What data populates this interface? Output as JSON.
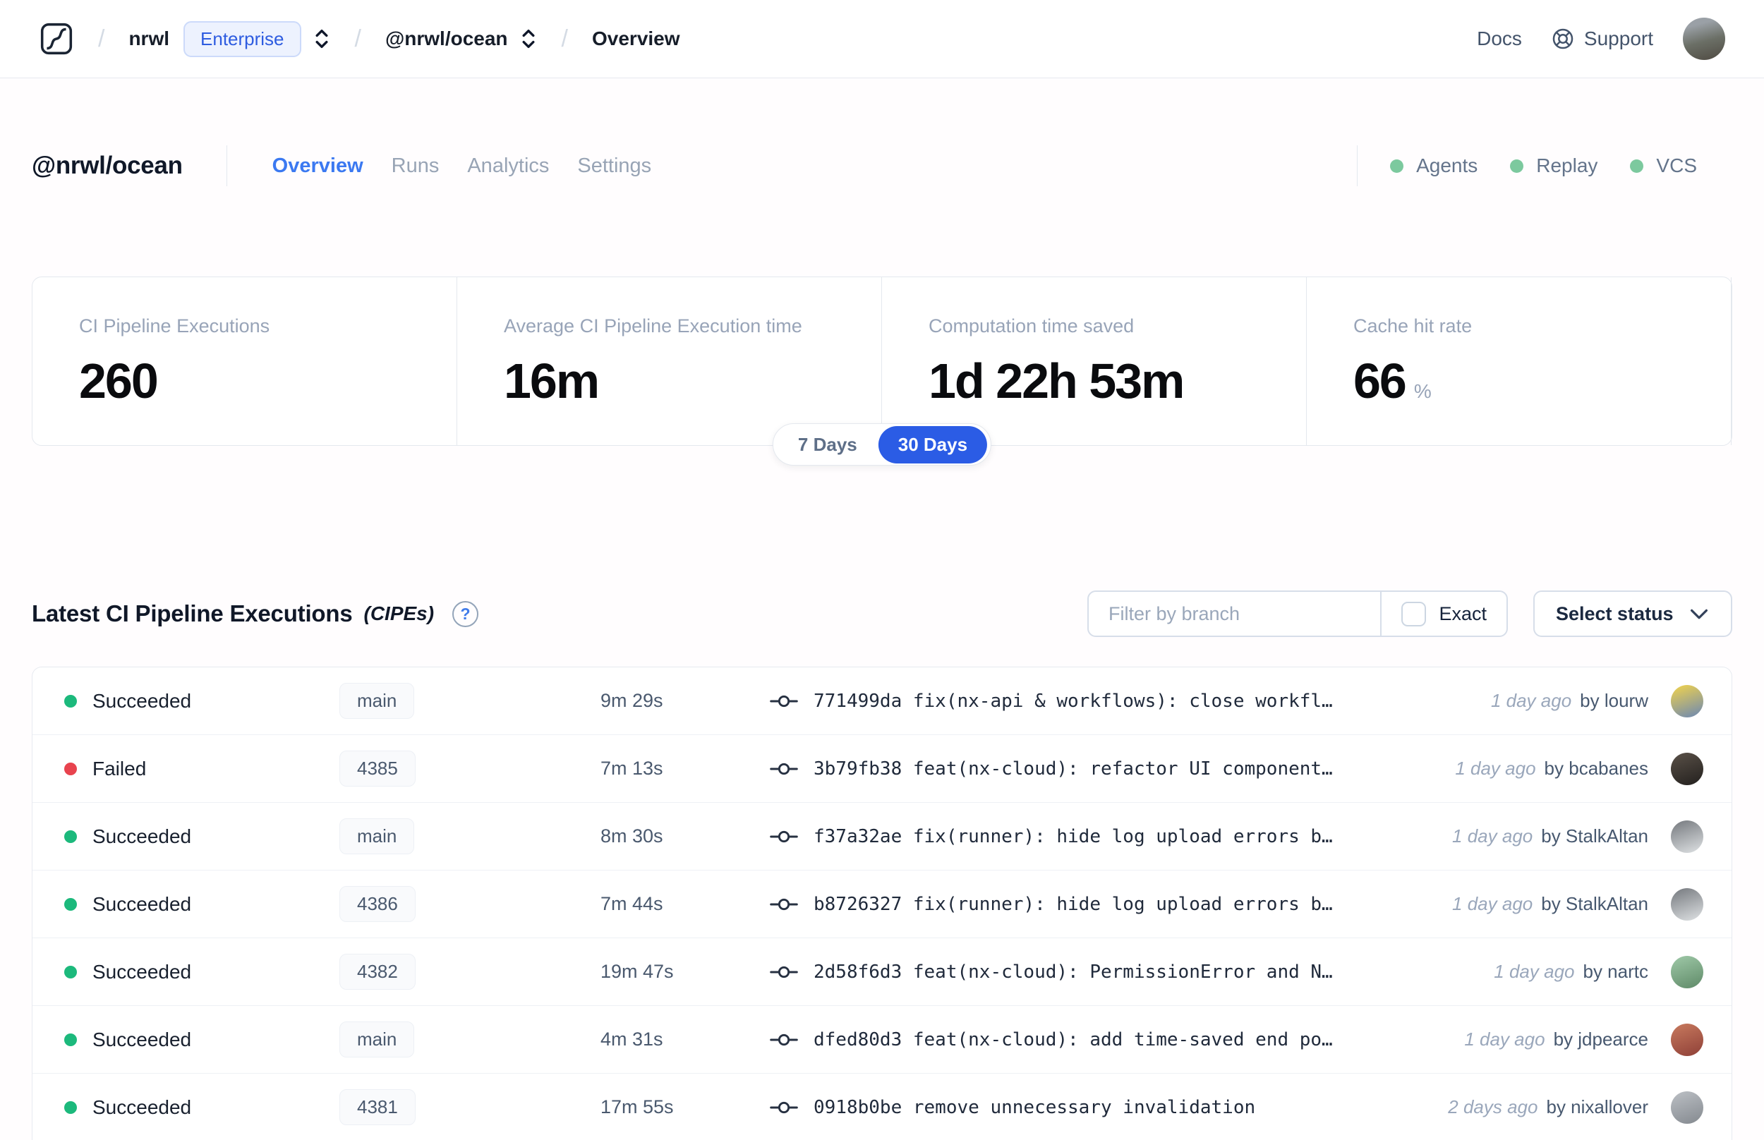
{
  "nav": {
    "breadcrumb": {
      "org": "nrwl",
      "org_badge": "Enterprise",
      "workspace": "@nrwl/ocean",
      "page": "Overview"
    },
    "docs_label": "Docs",
    "support_label": "Support"
  },
  "header": {
    "workspace": "@nrwl/ocean",
    "tabs": [
      {
        "label": "Overview",
        "active": true
      },
      {
        "label": "Runs",
        "active": false
      },
      {
        "label": "Analytics",
        "active": false
      },
      {
        "label": "Settings",
        "active": false
      }
    ],
    "statuses": [
      {
        "label": "Agents",
        "state_color": "#7cc99e"
      },
      {
        "label": "Replay",
        "state_color": "#7cc99e"
      },
      {
        "label": "VCS",
        "state_color": "#7cc99e"
      }
    ]
  },
  "stats": {
    "cards": [
      {
        "label": "CI Pipeline Executions",
        "value": "260"
      },
      {
        "label": "Average CI Pipeline Execution time",
        "value": "16m"
      },
      {
        "label": "Computation time saved",
        "value": "1d 22h 53m"
      },
      {
        "label": "Cache hit rate",
        "value": "66",
        "suffix": "%"
      }
    ],
    "range_toggle": {
      "options": [
        "7 Days",
        "30 Days"
      ],
      "selected": "30 Days"
    }
  },
  "cipe": {
    "title": "Latest CI Pipeline Executions",
    "title_suffix": "(CIPEs)",
    "filter_placeholder": "Filter by branch",
    "exact_label": "Exact",
    "status_button_label": "Select status",
    "rows": [
      {
        "status": "Succeeded",
        "status_color": "green",
        "branch": "main",
        "duration": "9m 29s",
        "commit": "771499da fix(nx-api & workflows): close workfl…",
        "time": "1 day ago",
        "author": "by lourw",
        "avatar": [
          "#f3d44b",
          "#6b87b4"
        ]
      },
      {
        "status": "Failed",
        "status_color": "red",
        "branch": "4385",
        "duration": "7m 13s",
        "commit": "3b79fb38 feat(nx-cloud): refactor UI component…",
        "time": "1 day ago",
        "author": "by bcabanes",
        "avatar": [
          "#5a5148",
          "#23201e"
        ]
      },
      {
        "status": "Succeeded",
        "status_color": "green",
        "branch": "main",
        "duration": "8m 30s",
        "commit": "f37a32ae fix(runner): hide log upload errors b…",
        "time": "1 day ago",
        "author": "by StalkAltan",
        "avatar": [
          "#74787d",
          "#dfe2e4"
        ]
      },
      {
        "status": "Succeeded",
        "status_color": "green",
        "branch": "4386",
        "duration": "7m 44s",
        "commit": "b8726327 fix(runner): hide log upload errors b…",
        "time": "1 day ago",
        "author": "by StalkAltan",
        "avatar": [
          "#74787d",
          "#dfe2e4"
        ]
      },
      {
        "status": "Succeeded",
        "status_color": "green",
        "branch": "4382",
        "duration": "19m 47s",
        "commit": "2d58f6d3 feat(nx-cloud): PermissionError and N…",
        "time": "1 day ago",
        "author": "by nartc",
        "avatar": [
          "#9fc9a8",
          "#5f8a68"
        ]
      },
      {
        "status": "Succeeded",
        "status_color": "green",
        "branch": "main",
        "duration": "4m 31s",
        "commit": "dfed80d3 feat(nx-cloud): add time-saved end po…",
        "time": "1 day ago",
        "author": "by jdpearce",
        "avatar": [
          "#c87a5e",
          "#8f4038"
        ]
      },
      {
        "status": "Succeeded",
        "status_color": "green",
        "branch": "4381",
        "duration": "17m 55s",
        "commit": "0918b0be remove unnecessary invalidation",
        "time": "2 days ago",
        "author": "by nixallover",
        "avatar": [
          "#bcc0c5",
          "#84898f"
        ]
      }
    ]
  },
  "colors": {
    "accent_blue": "#2b5ce5",
    "tab_active_blue": "#3b79f1",
    "success_green": "#1cb97c",
    "failed_red": "#e8434e",
    "legend_green": "#7cc99e"
  }
}
